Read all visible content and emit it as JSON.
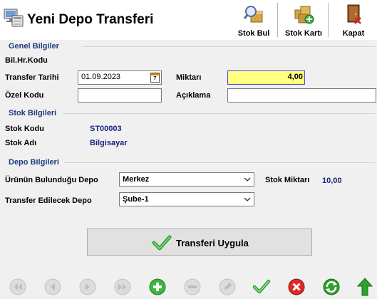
{
  "window": {
    "title": "Yeni Depo Transferi"
  },
  "toolbar": {
    "stok_bul": "Stok Bul",
    "stok_karti": "Stok Kartı",
    "kapat": "Kapat"
  },
  "genel": {
    "section": "Genel Bilgiler",
    "bil_hr_kodu_label": "Bil.Hr.Kodu",
    "transfer_tarihi_label": "Transfer Tarihi",
    "transfer_tarihi_value": "01.09.2023",
    "calendar_day": "7",
    "miktari_label": "Miktarı",
    "miktari_value": "4,00",
    "ozel_kodu_label": "Özel Kodu",
    "ozel_kodu_value": "",
    "aciklama_label": "Açıklama",
    "aciklama_value": ""
  },
  "stok": {
    "section": "Stok Bilgileri",
    "kodu_label": "Stok Kodu",
    "kodu_value": "ST00003",
    "adi_label": "Stok Adı",
    "adi_value": "Bilgisayar"
  },
  "depo": {
    "section": "Depo Bilgileri",
    "bulundugu_label": "Ürünün Bulunduğu Depo",
    "bulundugu_value": "Merkez",
    "stok_miktari_label": "Stok Miktarı",
    "stok_miktari_value": "10,00",
    "transfer_edilecek_label": "Transfer Edilecek Depo",
    "transfer_edilecek_value": "Şube-1"
  },
  "actions": {
    "apply_label": "Transferi Uygula"
  },
  "navigator": {
    "buttons": [
      "first",
      "prior",
      "next",
      "last",
      "insert",
      "delete",
      "edit",
      "post",
      "cancel",
      "refresh",
      "apply-updates"
    ]
  },
  "colors": {
    "section_title": "#1f3a80",
    "value_text": "#1a237e",
    "highlight_input": "#ffff80"
  }
}
